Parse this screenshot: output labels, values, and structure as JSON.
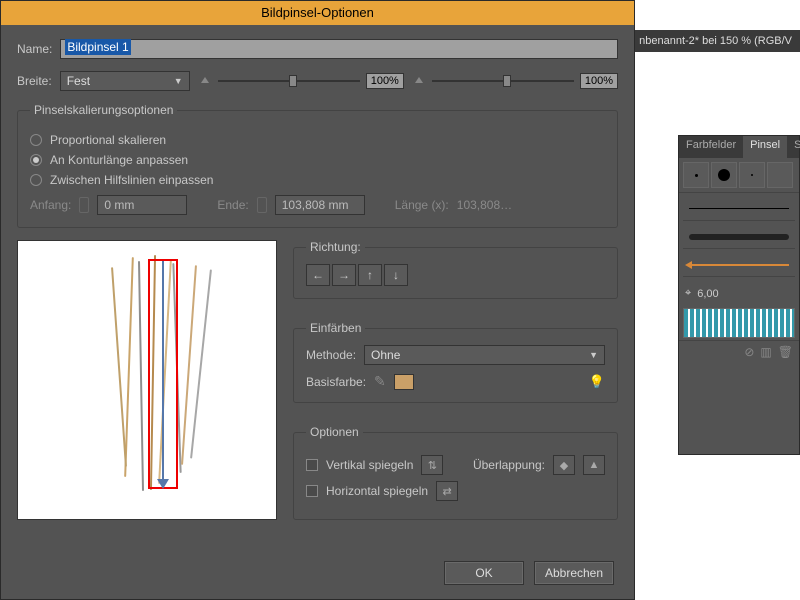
{
  "dialog": {
    "title": "Bildpinsel-Optionen",
    "name_label": "Name:",
    "name_value": "Bildpinsel 1",
    "width_label": "Breite:",
    "width_mode": "Fest",
    "width_pct_a": "100%",
    "width_pct_b": "100%",
    "scaling": {
      "legend": "Pinselskalierungsoptionen",
      "opt_proportional": "Proportional skalieren",
      "opt_contour": "An Konturlänge anpassen",
      "opt_guides": "Zwischen Hilfslinien einpassen",
      "selected": "opt_contour",
      "start_label": "Anfang:",
      "start_value": "0 mm",
      "end_label": "Ende:",
      "end_value": "103,808 mm",
      "length_label": "Länge (x):",
      "length_value": "103,808…"
    },
    "direction": {
      "legend": "Richtung:"
    },
    "colorize": {
      "legend": "Einfärben",
      "method_label": "Methode:",
      "method_value": "Ohne",
      "key_label": "Basisfarbe:",
      "key_hex": "#caa068"
    },
    "options": {
      "legend": "Optionen",
      "flip_v": "Vertikal spiegeln",
      "flip_h": "Horizontal spiegeln",
      "overlap_label": "Überlappung:"
    },
    "buttons": {
      "ok": "OK",
      "cancel": "Abbrechen"
    }
  },
  "app": {
    "doc_tab": "nbenannt-2* bei 150 % (RGB/V",
    "panel_tabs": {
      "a": "Farbfelder",
      "b": "Pinsel",
      "c": "Sy"
    },
    "brush_size": "6,00"
  }
}
